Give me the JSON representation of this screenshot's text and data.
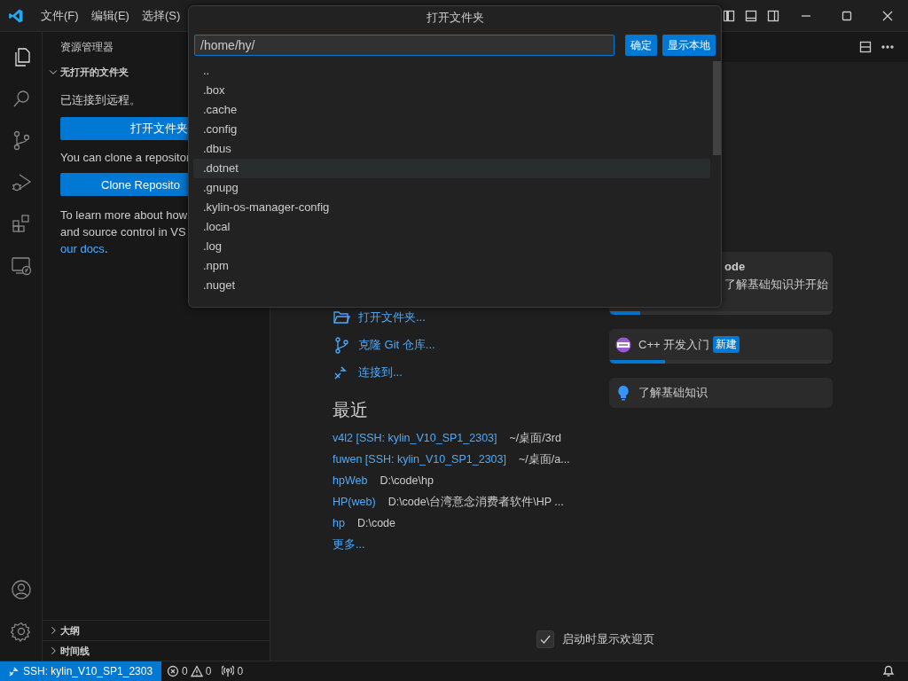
{
  "title_bar": {
    "menus": [
      "文件(F)",
      "编辑(E)",
      "选择(S)"
    ]
  },
  "activity_bar": {
    "items": [
      {
        "kind": "explorer",
        "selected": true
      },
      {
        "kind": "search",
        "selected": false
      },
      {
        "kind": "source_control",
        "selected": false
      },
      {
        "kind": "run_debug",
        "selected": false
      },
      {
        "kind": "extensions",
        "selected": false
      },
      {
        "kind": "remote",
        "selected": false
      }
    ],
    "bottom": [
      {
        "kind": "account"
      },
      {
        "kind": "settings"
      }
    ]
  },
  "sidebar": {
    "title": "资源管理器",
    "section": {
      "label": "无打开的文件夹",
      "expanded": true
    },
    "connected_text": "已连接到远程。",
    "open_folder_button": "打开文件夹",
    "clone_text": "You can clone a repositor",
    "clone_button": "Clone Reposito",
    "learn_lines": [
      "To learn more about how",
      "and source control in VS"
    ],
    "docs_link": "our docs",
    "docs_suffix": ".",
    "bottom_sections": [
      {
        "label": "大纲",
        "expanded": false
      },
      {
        "label": "时间线",
        "expanded": false
      }
    ]
  },
  "dialog": {
    "title": "打开文件夹",
    "path": "/home/hy/",
    "buttons": [
      "确定",
      "显示本地"
    ],
    "entries": [
      {
        "name": "..",
        "selected": false
      },
      {
        "name": ".box",
        "selected": false
      },
      {
        "name": ".cache",
        "selected": false
      },
      {
        "name": ".config",
        "selected": false
      },
      {
        "name": ".dbus",
        "selected": false
      },
      {
        "name": ".dotnet",
        "selected": true
      },
      {
        "name": ".gnupg",
        "selected": false
      },
      {
        "name": ".kylin-os-manager-config",
        "selected": false
      },
      {
        "name": ".local",
        "selected": false
      },
      {
        "name": ".log",
        "selected": false
      },
      {
        "name": ".npm",
        "selected": false
      },
      {
        "name": ".nuget",
        "selected": false
      }
    ]
  },
  "welcome": {
    "start": [
      {
        "kind": "folder",
        "label": "打开文件夹..."
      },
      {
        "kind": "git",
        "label": "克隆 Git 仓库..."
      },
      {
        "kind": "remote",
        "label": "连接到..."
      }
    ],
    "recent_title": "最近",
    "recent": [
      {
        "name": "v4l2 [SSH: kylin_V10_SP1_2303]",
        "path": "~/桌面/3rd"
      },
      {
        "name": "fuwen [SSH: kylin_V10_SP1_2303]",
        "path": "~/桌面/a..."
      },
      {
        "name": "hpWeb",
        "path": "D:\\code\\hp"
      },
      {
        "name": "HP(web)",
        "path": "D:\\code\\台湾意念消费者软件\\HP ..."
      },
      {
        "name": "hp",
        "path": "D:\\code"
      }
    ],
    "more": "更多...",
    "walkthroughs": [
      {
        "kind": "partial",
        "title": "ode",
        "description": "了解基础知识并开始",
        "level": 0.14
      },
      {
        "kind": "cpp",
        "title": "C++ 开发入门",
        "badge": "新建",
        "level": 0.25
      },
      {
        "kind": "tip",
        "title": "了解基础知识"
      }
    ],
    "show_on_startup": {
      "label": "启动时显示欢迎页",
      "checked": true
    }
  },
  "status_bar": {
    "remote": "SSH: kylin_V10_SP1_2303",
    "errors": "0",
    "warnings": "0",
    "ports": "0"
  }
}
